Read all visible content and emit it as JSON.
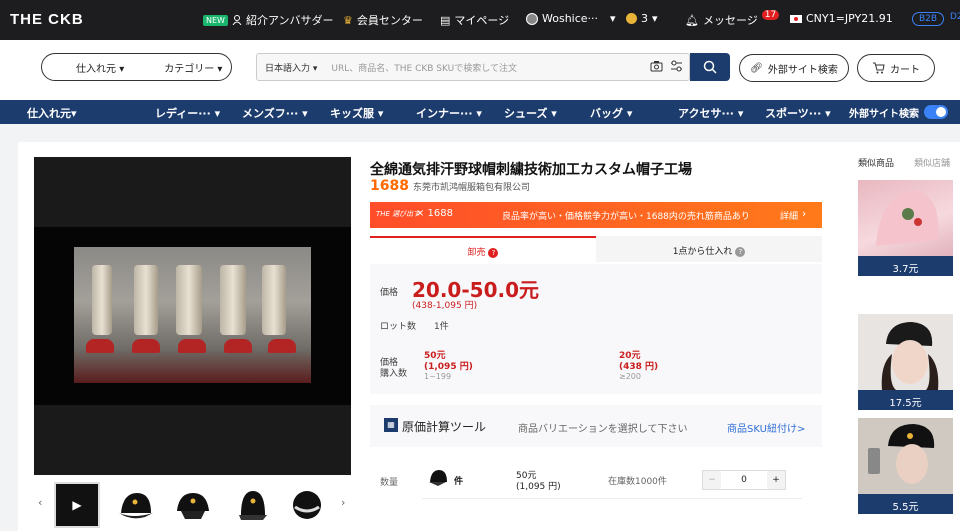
{
  "topbar": {
    "logo": "THE CKB",
    "new_badge": "NEW",
    "ambassador": "紹介アンバサダー",
    "member_center": "会員センター",
    "my_page": "マイページ",
    "user": "Woshice···",
    "coins": "3",
    "messages": "メッセージ",
    "messages_count": "17",
    "currency": "CNY1=JPY21.91",
    "b2b": "B2B",
    "d": "D2"
  },
  "search": {
    "supplier": "仕入れ元",
    "category": "カテゴリー",
    "lang": "日本語入力",
    "placeholder": "URL、商品名、THE CKB SKUで検索して注文",
    "external_search": "外部サイト検索",
    "cart": "カート"
  },
  "nav": {
    "items": [
      "仕入れ元",
      "レディー···",
      "メンズフ···",
      "キッズ服",
      "インナー···",
      "シューズ",
      "バッグ",
      "アクセサ···",
      "スポーツ···"
    ],
    "external": "外部サイト検索"
  },
  "product": {
    "title": "全綿通気排汗野球帽刺繍技術加工カスタム帽子工場",
    "platform": "1688",
    "supplier": "东莞市凯鸿帽服箱包有限公司",
    "banner_brand": "THE 選び出す",
    "banner_platform": "× 1688",
    "banner_text": "良品率が高い・価格競争力が高い・1688内の売れ筋商品あり",
    "banner_link": "詳細"
  },
  "tabs": {
    "wholesale": "卸売",
    "dropship": "1点から仕入れ"
  },
  "pricing": {
    "price_label": "価格",
    "price": "20.0-50.0元",
    "price_jpy": "(438-1,095 円)",
    "lot_label": "ロット数",
    "lot_value": "1件",
    "tier_label_1": "価格",
    "tier_label_2": "購入数",
    "tiers": [
      {
        "price": "50元",
        "jpy": "(1,095 円)",
        "range": "1~199"
      },
      {
        "price": "20元",
        "jpy": "(438 円)",
        "range": "≥200"
      }
    ]
  },
  "tool": {
    "title": "原価計算ツール",
    "hint": "商品バリエーションを選択して下さい",
    "link": "商品SKU紐付け>"
  },
  "quantity": {
    "label": "数量",
    "unit": "件",
    "price": "50元",
    "price_jpy": "(1,095 円)",
    "stock": "在庫数1000件",
    "value": "0",
    "minus": "−",
    "plus": "+"
  },
  "sidebar": {
    "tab_similar_products": "類似商品",
    "tab_similar_shops": "類似店舗",
    "items": [
      {
        "price": "3.7元"
      },
      {
        "price": "17.5元"
      },
      {
        "price": "5.5元"
      }
    ]
  },
  "colors": {
    "brand_navy": "#1d3c6e",
    "price_red": "#e02020",
    "accent_orange": "#ff6a00"
  }
}
